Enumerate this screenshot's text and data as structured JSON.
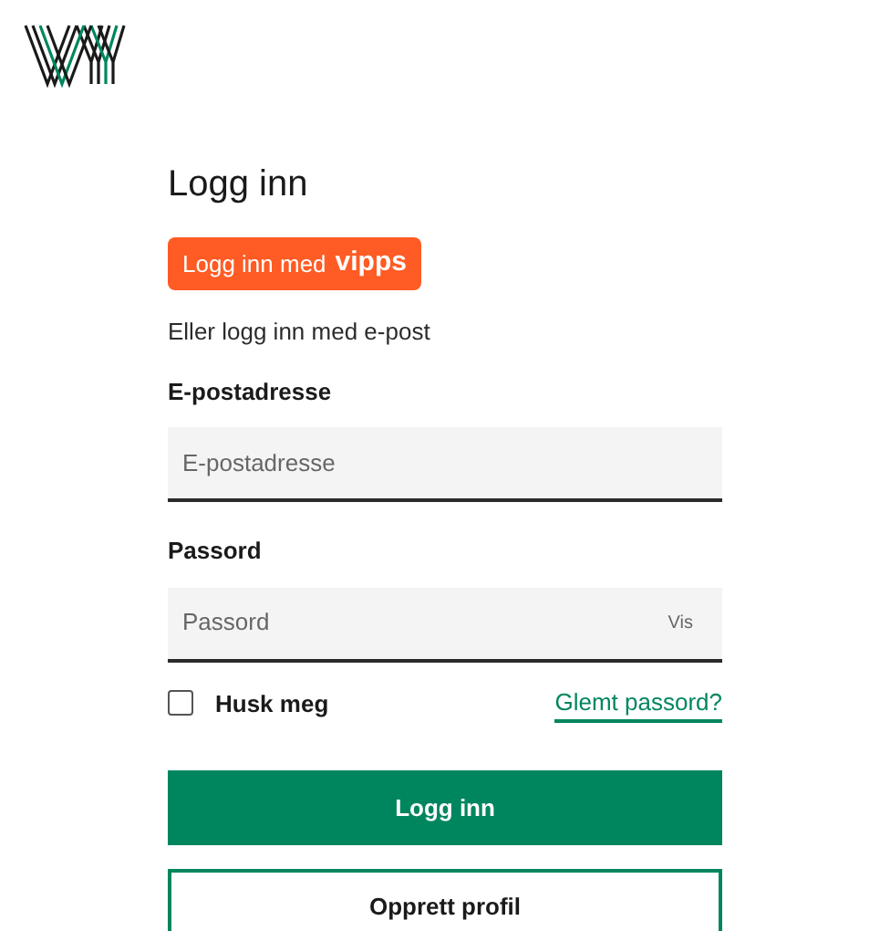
{
  "title": "Logg inn",
  "vipps_button": {
    "label": "Logg inn med",
    "brand": "vipps"
  },
  "alt_text": "Eller logg inn med e-post",
  "email": {
    "label": "E-postadresse",
    "placeholder": "E-postadresse"
  },
  "password": {
    "label": "Passord",
    "placeholder": "Passord",
    "toggle": "Vis"
  },
  "remember": {
    "label": "Husk meg",
    "checked": false
  },
  "forgot_link": "Glemt passord?",
  "buttons": [
    {
      "label": "Logg inn",
      "kind": "primary"
    },
    {
      "label": "Opprett profil",
      "kind": "secondary"
    }
  ]
}
